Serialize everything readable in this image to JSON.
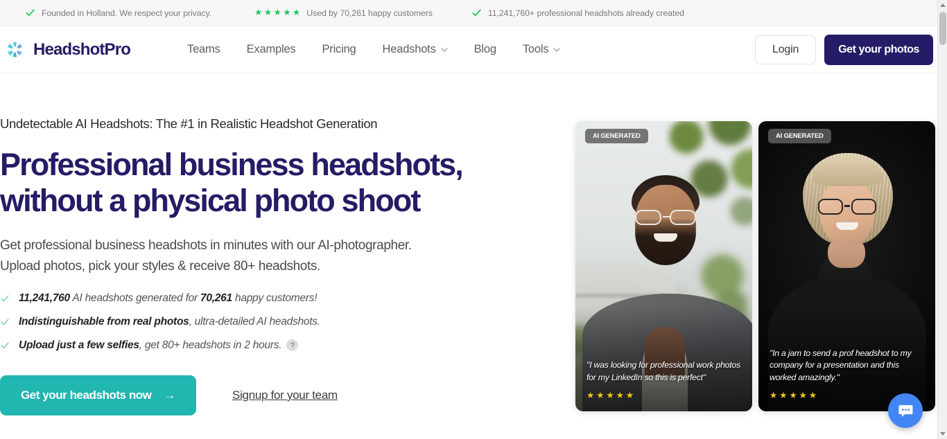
{
  "announcement": {
    "items": [
      {
        "icon": "check-icon",
        "text": "Founded in Holland. We respect your privacy."
      },
      {
        "icon": "stars-icon",
        "stars": 5,
        "text": "Used by 70,261 happy customers"
      },
      {
        "icon": "check-icon",
        "text": "11,241,760+ professional headshots already created"
      }
    ]
  },
  "header": {
    "brand": {
      "name": "HeadshotPro",
      "logo_icon": "headshotpro-logo-icon"
    },
    "nav": [
      {
        "label": "Teams",
        "has_caret": false
      },
      {
        "label": "Examples",
        "has_caret": false
      },
      {
        "label": "Pricing",
        "has_caret": false
      },
      {
        "label": "Headshots",
        "has_caret": true
      },
      {
        "label": "Blog",
        "has_caret": false
      },
      {
        "label": "Tools",
        "has_caret": true
      }
    ],
    "login_label": "Login",
    "cta_label": "Get your photos"
  },
  "hero": {
    "eyebrow": "Undetectable AI Headshots: The #1 in Realistic Headshot Generation",
    "heading_line1": "Professional business headshots,",
    "heading_line2": "without a physical photo shoot",
    "subtitle_line1": "Get professional business headshots in minutes with our AI-photographer.",
    "subtitle_line2": "Upload photos, pick your styles & receive 80+ headshots.",
    "bullets": [
      {
        "bold_1": "11,241,760",
        "mid": " AI headshots generated for ",
        "bold_2": "70,261",
        "tail": " happy customers!",
        "help": false
      },
      {
        "bold_1": "Indistinguishable from real photos",
        "mid": ", ultra-detailed AI headshots.",
        "bold_2": "",
        "tail": "",
        "help": false
      },
      {
        "bold_1": "Upload just a few selfies",
        "mid": ", get 80+ headshots in 2 hours.",
        "bold_2": "",
        "tail": "",
        "help": true,
        "help_glyph": "?"
      }
    ],
    "cta_primary": "Get your headshots now",
    "cta_primary_arrow": "→",
    "cta_secondary": "Signup for your team"
  },
  "cards": [
    {
      "badge": "AI GENERATED",
      "quote": "\"I was looking for professional work photos for my LinkedIn so this is perfect\"",
      "stars": 5,
      "subject": "smiling man with clear-frame glasses, beard, grey suit, outdoor green background"
    },
    {
      "badge": "AI GENERATED",
      "quote": "\"In a jam to send a prof headshot to my company for a presentation and this worked amazingly.\"",
      "stars": 5,
      "subject": "smiling woman with blonde bob, dark glasses, black turtleneck, black background"
    }
  ],
  "chat_widget": {
    "icon": "chat-bubble-icon",
    "dots": "•••"
  },
  "scrollbar": {
    "up_icon": "scroll-arrow-up-icon",
    "down_icon": "scroll-arrow-down-icon"
  },
  "colors": {
    "brand_navy": "#241c66",
    "teal_cta": "#21b6b0",
    "check_green": "#22c55e",
    "star_gold": "#f5c518",
    "chat_blue": "#4285f4"
  }
}
